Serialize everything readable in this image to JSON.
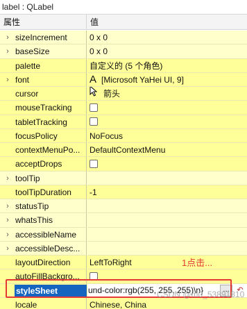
{
  "window": {
    "title": "label : QLabel"
  },
  "columns": {
    "property": "属性",
    "value": "值"
  },
  "rows": [
    {
      "name": "sizeIncrement",
      "value": "0 x 0",
      "expandable": true,
      "shade": "a"
    },
    {
      "name": "baseSize",
      "value": "0 x 0",
      "expandable": true,
      "shade": "a"
    },
    {
      "name": "palette",
      "value": "自定义的 (5 个角色)",
      "expandable": false,
      "shade": "b"
    },
    {
      "name": "font",
      "value": "[Microsoft YaHei UI, 9]",
      "icon": "font-A-icon",
      "icon_text": "A",
      "expandable": true,
      "shade": "b"
    },
    {
      "name": "cursor",
      "value": "箭头",
      "icon": "arrow-cursor-icon",
      "expandable": false,
      "shade": "b"
    },
    {
      "name": "mouseTracking",
      "value": "",
      "checkbox": true,
      "checked": false,
      "expandable": false,
      "shade": "b"
    },
    {
      "name": "tabletTracking",
      "value": "",
      "checkbox": true,
      "checked": false,
      "expandable": false,
      "shade": "b"
    },
    {
      "name": "focusPolicy",
      "value": "NoFocus",
      "expandable": false,
      "shade": "b"
    },
    {
      "name": "contextMenuPo...",
      "value": "DefaultContextMenu",
      "expandable": false,
      "shade": "b"
    },
    {
      "name": "acceptDrops",
      "value": "",
      "checkbox": true,
      "checked": false,
      "expandable": false,
      "shade": "b"
    },
    {
      "name": "toolTip",
      "value": "",
      "expandable": true,
      "shade": "a"
    },
    {
      "name": "toolTipDuration",
      "value": "-1",
      "expandable": false,
      "shade": "b"
    },
    {
      "name": "statusTip",
      "value": "",
      "expandable": true,
      "shade": "a"
    },
    {
      "name": "whatsThis",
      "value": "",
      "expandable": true,
      "shade": "a"
    },
    {
      "name": "accessibleName",
      "value": "",
      "expandable": true,
      "shade": "a"
    },
    {
      "name": "accessibleDesc...",
      "value": "",
      "expandable": true,
      "shade": "a"
    },
    {
      "name": "layoutDirection",
      "value": "LeftToRight",
      "expandable": false,
      "shade": "b"
    },
    {
      "name": "autoFillBackgro...",
      "value": "",
      "checkbox": true,
      "checked": false,
      "expandable": false,
      "shade": "b"
    },
    {
      "name": "styleSheet",
      "value": "und-color:rgb(255, 255, 255)\\n}",
      "selected": true,
      "button_label": "...",
      "reset_icon": "reset-arrow-icon",
      "expandable": false,
      "shade": "b"
    },
    {
      "name": "locale",
      "value": "Chinese, China",
      "expandable": false,
      "shade": "b"
    }
  ],
  "annotation": {
    "text": "1点击...",
    "color": "#e53935"
  },
  "watermark": "CSDN @m0_53891810",
  "colors": {
    "row_light": "#ffffcc",
    "row_dark": "#ffff99",
    "selection": "#1565c0",
    "highlight_box": "#e53935"
  }
}
